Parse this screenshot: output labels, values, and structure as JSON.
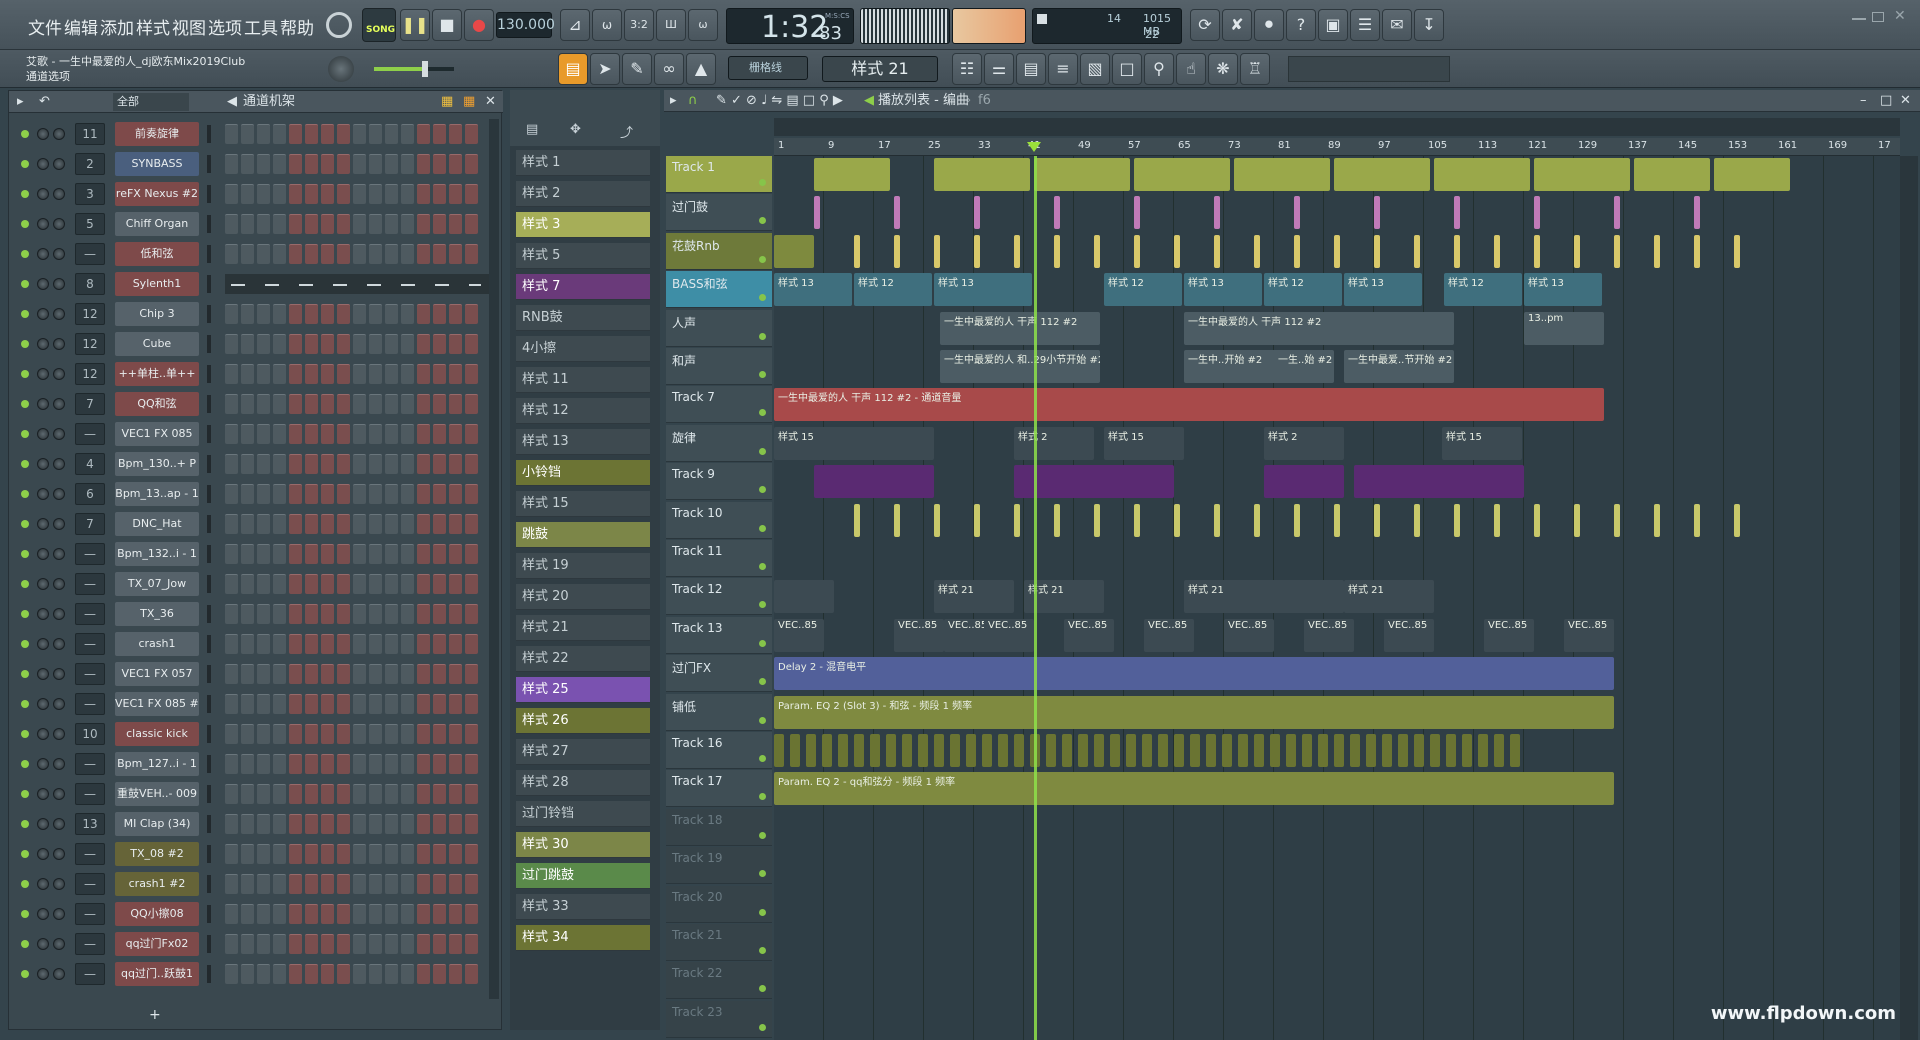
{
  "menu": [
    "文件",
    "编辑",
    "添加",
    "样式",
    "视图",
    "选项",
    "工具",
    "帮助"
  ],
  "transport": {
    "song_label": "SONG",
    "tempo": "130.000",
    "time": "1:32",
    "time_sub": "83",
    "time_unit": "M:S:CS",
    "mem": "1015 MB",
    "cpu_num": "14",
    "poly_num": "22"
  },
  "project": {
    "title": "艾歌 - 一生中最爱的人_dj欧东Mix2019Club",
    "subtitle": "通道选项"
  },
  "toolbar2": {
    "snap": "栅格线",
    "pattern": "样式 21"
  },
  "channel_rack": {
    "filter": "全部",
    "title": "通道机架",
    "add": "+",
    "channels": [
      {
        "num": "11",
        "name": "前奏旋律",
        "color": "red"
      },
      {
        "num": "2",
        "name": "SYNBASS",
        "color": "blue"
      },
      {
        "num": "3",
        "name": "reFX Nexus #2",
        "color": "red"
      },
      {
        "num": "5",
        "name": "Chiff Organ",
        "color": "gray"
      },
      {
        "num": "—",
        "name": "低和弦",
        "color": "red"
      },
      {
        "num": "8",
        "name": "Sylenth1",
        "color": "red"
      },
      {
        "num": "12",
        "name": "Chip 3",
        "color": "gray"
      },
      {
        "num": "12",
        "name": "Cube",
        "color": "gray"
      },
      {
        "num": "12",
        "name": "++单柱..单++",
        "color": "red"
      },
      {
        "num": "7",
        "name": "QQ和弦",
        "color": "red"
      },
      {
        "num": "—",
        "name": "VEC1 FX 085",
        "color": "gray"
      },
      {
        "num": "4",
        "name": "Bpm_130..+ P",
        "color": "gray"
      },
      {
        "num": "6",
        "name": "Bpm_13..ap - 1",
        "color": "gray"
      },
      {
        "num": "7",
        "name": "DNC_Hat",
        "color": "gray"
      },
      {
        "num": "—",
        "name": "Bpm_132..i - 1",
        "color": "gray"
      },
      {
        "num": "—",
        "name": "TX_07_Jow",
        "color": "gray"
      },
      {
        "num": "—",
        "name": "TX_36",
        "color": "gray"
      },
      {
        "num": "—",
        "name": "crash1",
        "color": "gray"
      },
      {
        "num": "—",
        "name": "VEC1 FX 057",
        "color": "gray"
      },
      {
        "num": "—",
        "name": "VEC1 FX 085 #2",
        "color": "gray"
      },
      {
        "num": "10",
        "name": "classic kick",
        "color": "red"
      },
      {
        "num": "—",
        "name": "Bpm_127..i - 1",
        "color": "gray"
      },
      {
        "num": "—",
        "name": "重鼓VEH..- 009",
        "color": "gray"
      },
      {
        "num": "13",
        "name": "MI Clap (34)",
        "color": "gray"
      },
      {
        "num": "—",
        "name": "TX_08 #2",
        "color": "olive"
      },
      {
        "num": "—",
        "name": "crash1 #2",
        "color": "olive"
      },
      {
        "num": "—",
        "name": "QQ小擦08",
        "color": "red"
      },
      {
        "num": "—",
        "name": "qq过门Fx02",
        "color": "red"
      },
      {
        "num": "—",
        "name": "qq过门..跃鼓1",
        "color": "red"
      }
    ]
  },
  "patterns": [
    {
      "name": "样式 1",
      "style": "gry2"
    },
    {
      "name": "样式 2",
      "style": "gry2"
    },
    {
      "name": "样式 3",
      "style": "yel"
    },
    {
      "name": "样式 5",
      "style": "gry2"
    },
    {
      "name": "样式 7",
      "style": "pur"
    },
    {
      "name": "RNB鼓",
      "style": "gry2"
    },
    {
      "name": "4小擦",
      "style": "gry2"
    },
    {
      "name": "样式 11",
      "style": "gry2"
    },
    {
      "name": "样式 12",
      "style": "gry2"
    },
    {
      "name": "样式 13",
      "style": "gry2"
    },
    {
      "name": "小铃铛",
      "style": "olv"
    },
    {
      "name": "样式 15",
      "style": "gry2"
    },
    {
      "name": "跳鼓",
      "style": "olv2"
    },
    {
      "name": "样式 19",
      "style": "gry2"
    },
    {
      "name": "样式 20",
      "style": "gry2"
    },
    {
      "name": "样式 21",
      "style": "gry2"
    },
    {
      "name": "样式 22",
      "style": "gry2"
    },
    {
      "name": "样式 25",
      "style": "pur2"
    },
    {
      "name": "样式 26",
      "style": "olv"
    },
    {
      "name": "样式 27",
      "style": "gry2"
    },
    {
      "name": "样式 28",
      "style": "gry2"
    },
    {
      "name": "过门铃铛",
      "style": "gry2"
    },
    {
      "name": "样式 30",
      "style": "olv2"
    },
    {
      "name": "过门跳鼓",
      "style": "grn"
    },
    {
      "name": "样式 33",
      "style": "gry2"
    },
    {
      "name": "样式 34",
      "style": "olv"
    }
  ],
  "playlist": {
    "title": "播放列表 - 编曲",
    "crumb": "f6",
    "ruler": [
      "1",
      "9",
      "17",
      "25",
      "33",
      "41",
      "49",
      "57",
      "65",
      "73",
      "81",
      "89",
      "97",
      "105",
      "113",
      "121",
      "129",
      "137",
      "145",
      "153",
      "161",
      "169",
      "17"
    ],
    "tracks": [
      "Track 1",
      "过门鼓",
      "花鼓Rnb",
      "BASS和弦",
      "人声",
      "和声",
      "Track 7",
      "旋律",
      "Track 9",
      "Track 10",
      "Track 11",
      "Track 12",
      "Track 13",
      "过门FX",
      "铺低",
      "Track 16",
      "Track 17",
      "Track 18",
      "Track 19",
      "Track 20",
      "Track 21",
      "Track 22",
      "Track 23"
    ],
    "dim_from": 17,
    "clip_labels": {
      "bass1": "样式 13",
      "bass2": "样式 12",
      "voc1": "一生中最爱的人 干声 112 #2",
      "voc2": "一生中最爱的人 干声 112 #2",
      "voc3": "13..pm",
      "har1": "一生中最爱的人 和..29小节开始 #2",
      "har2": "一生中..开始 #2",
      "har3": "一生..始 #2",
      "har4": "一生中最爱..节开始 #2",
      "t7": "一生中最爱的人 干声 112 #2 - 通道音量",
      "mel1": "样式 15",
      "mel2": "样式 2",
      "t12": "样式 21",
      "t13": "VEC..85",
      "fx": "Delay 2 - 混音电平",
      "pad": "Param. EQ 2 (Slot 3) - 和弦 - 频段 1 频率",
      "t17": "Param. EQ 2 - qq和弦分 - 频段 1 频率"
    }
  },
  "watermark": "www.flpdown.com",
  "colors": {
    "olive": "#9aa84a",
    "blue": "#3e8ea6",
    "purple": "#5a2a72",
    "red": "#b44a4a",
    "teal": "#4a8a8a"
  }
}
